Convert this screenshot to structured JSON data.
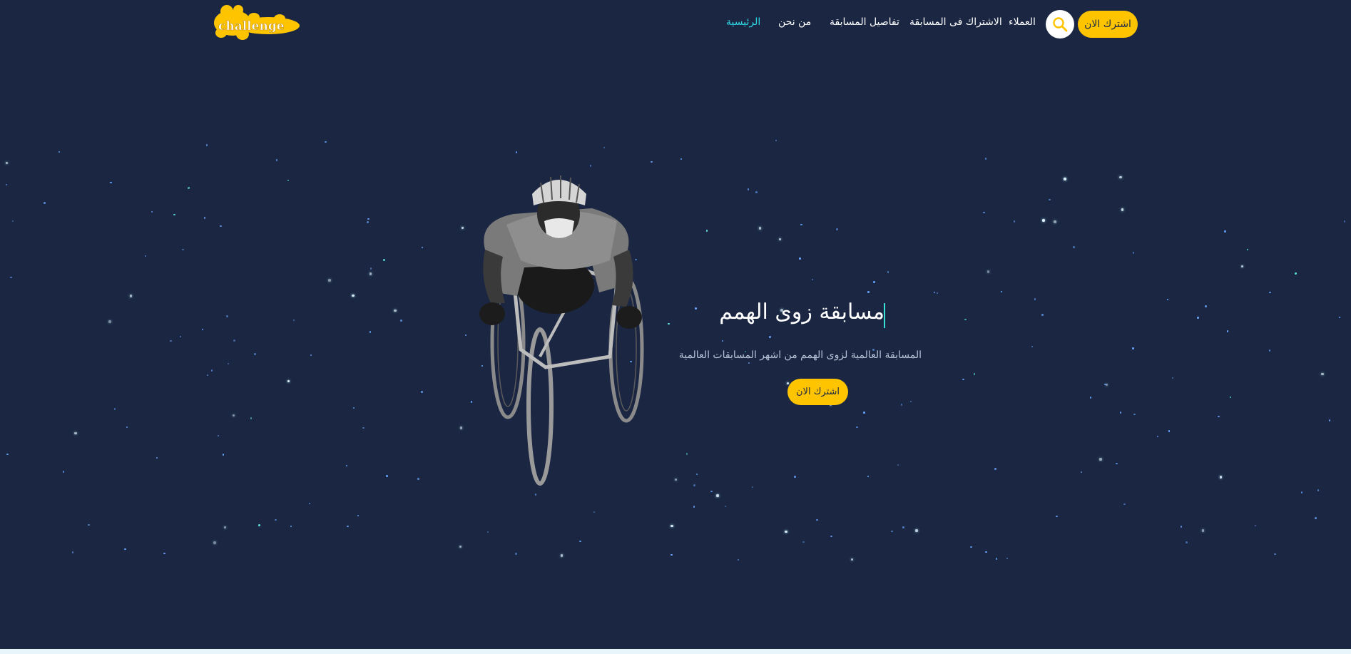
{
  "brand": {
    "logo_text": "challenge"
  },
  "nav": {
    "items": [
      {
        "label": "الرئيسية",
        "active": true
      },
      {
        "label": "من نحن",
        "active": false
      },
      {
        "label": "تفاصيل المسابقة",
        "active": false
      },
      {
        "label": "الاشتراك فى المسابقة",
        "active": false
      },
      {
        "label": "العملاء",
        "active": false
      }
    ],
    "search_icon": "search-icon",
    "cta_label": "اشترك الان"
  },
  "hero": {
    "title": "مسابقة زوى الهمم",
    "subtitle": "المسابقة العالمية لزوى الهمم من اشهر المسابقات العالمية",
    "cta_label": "اشترك الان",
    "image": "wheelchair-athlete"
  },
  "colors": {
    "background": "#1b2742",
    "accent_yellow": "#ffc400",
    "active_link": "#2fd6e6",
    "star": "#6aa6ff"
  }
}
